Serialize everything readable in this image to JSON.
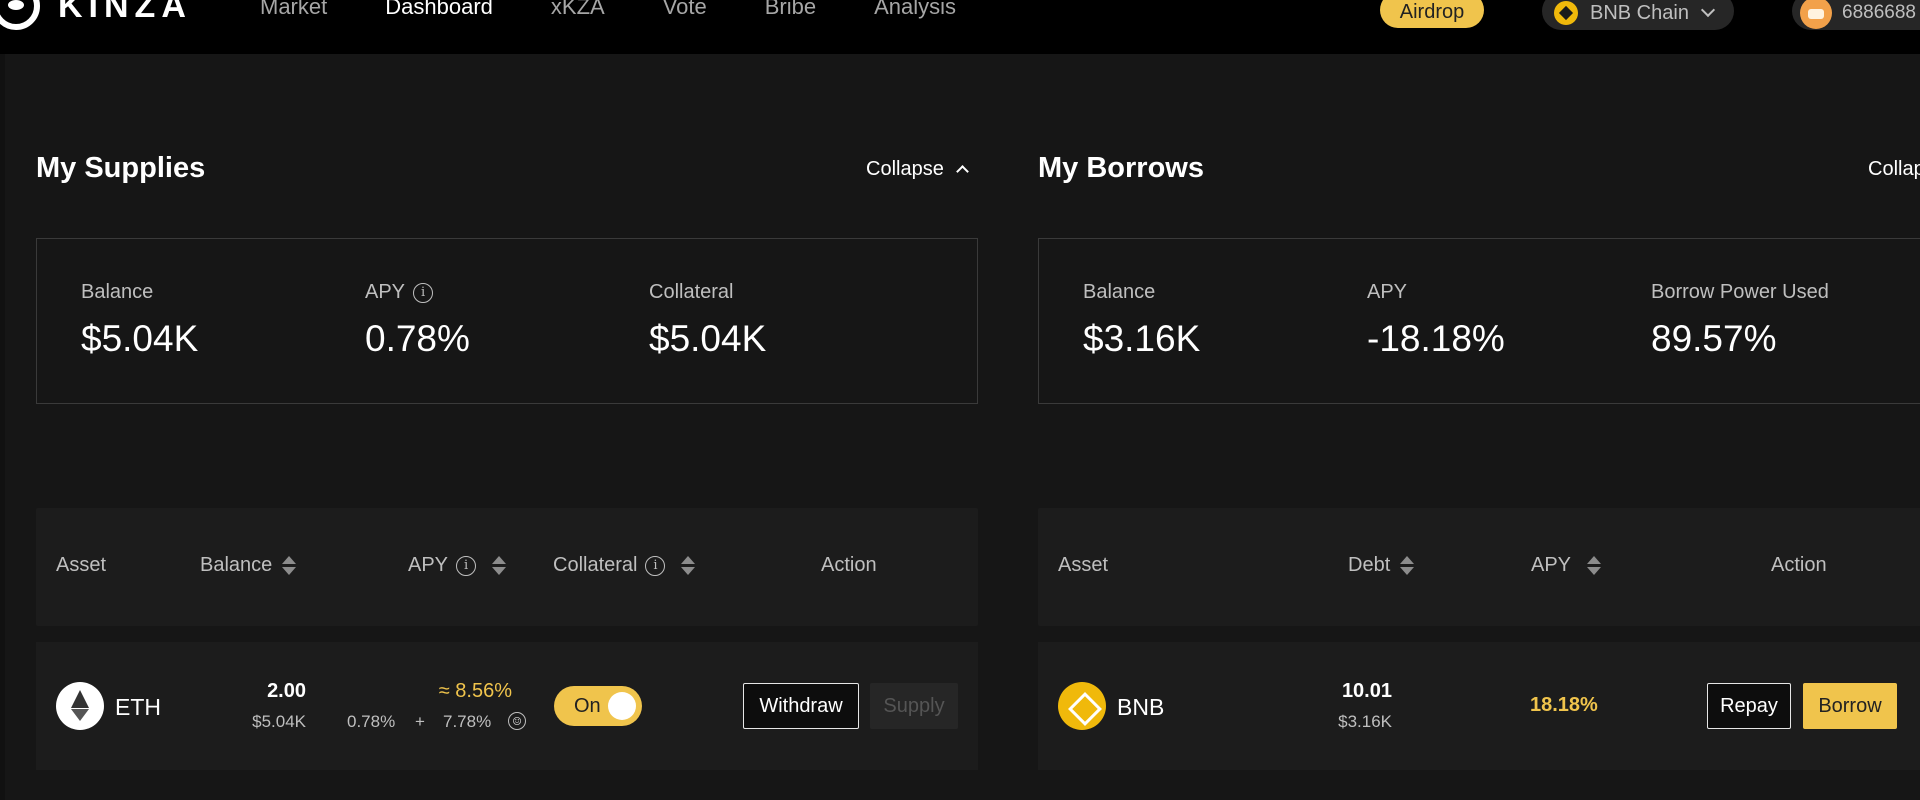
{
  "brand": {
    "name": "KINZA"
  },
  "nav": {
    "items": [
      "Market",
      "Dashboard",
      "xKZA",
      "Vote",
      "Bribe",
      "Analysis"
    ],
    "active": "Dashboard"
  },
  "header": {
    "airdrop_label": "Airdrop",
    "chain_label": "BNB Chain",
    "wallet_label": "6886688"
  },
  "supplies": {
    "title": "My Supplies",
    "collapse_label": "Collapse",
    "summary": {
      "balance_label": "Balance",
      "balance_value": "$5.04K",
      "apy_label": "APY",
      "apy_value": "0.78%",
      "collateral_label": "Collateral",
      "collateral_value": "$5.04K"
    },
    "columns": {
      "asset": "Asset",
      "balance": "Balance",
      "apy": "APY",
      "collateral": "Collateral",
      "action": "Action"
    },
    "rows": [
      {
        "asset": "ETH",
        "balance": "2.00",
        "balance_usd": "$5.04K",
        "apy_total": "≈ 8.56%",
        "apy_base": "0.78%",
        "apy_plus": "+",
        "apy_bonus": "7.78%",
        "collateral_toggle": "On",
        "withdraw_label": "Withdraw",
        "supply_label": "Supply"
      }
    ]
  },
  "borrows": {
    "title": "My Borrows",
    "collapse_label": "Collap",
    "summary": {
      "balance_label": "Balance",
      "balance_value": "$3.16K",
      "apy_label": "APY",
      "apy_value": "-18.18%",
      "power_label": "Borrow Power Used",
      "power_value": "89.57%"
    },
    "columns": {
      "asset": "Asset",
      "debt": "Debt",
      "apy": "APY",
      "action": "Action"
    },
    "rows": [
      {
        "asset": "BNB",
        "debt": "10.01",
        "debt_usd": "$3.16K",
        "apy": "18.18%",
        "repay_label": "Repay",
        "borrow_label": "Borrow"
      }
    ]
  },
  "colors": {
    "accent": "#f0c44c",
    "background": "#161616",
    "panel": "#1c1c1c"
  }
}
